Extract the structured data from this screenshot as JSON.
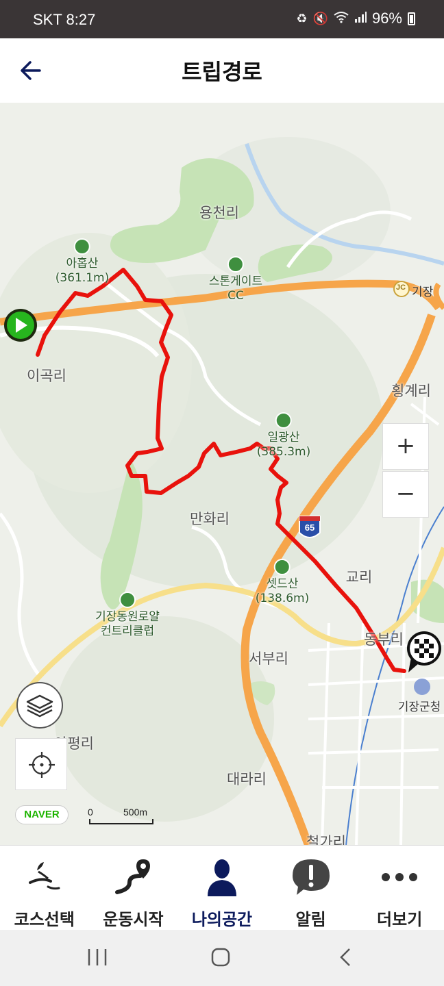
{
  "status_bar": {
    "carrier": "SKT",
    "time": "8:27",
    "battery": "96%",
    "icons": [
      "data-saver-icon",
      "mute-icon",
      "wifi-icon",
      "signal-icon",
      "battery-icon"
    ]
  },
  "app_bar": {
    "title": "트립경로",
    "back_icon": "arrow-left-icon"
  },
  "map": {
    "place_labels": [
      "용천리",
      "이곡리",
      "횡계리",
      "만화리",
      "교리",
      "동부리",
      "서부리",
      "기장군청",
      "아평리",
      "대라리",
      "철가리"
    ],
    "poi_labels": {
      "ahop": "아홉산\n(361.1m)",
      "stonegate": "스톤게이트\nCC",
      "ilgwang": "일광산\n(385.3m)",
      "setdeu": "셋드산\n(138.6m)",
      "golfclub": "기장동원로얄\n컨트리클럽"
    },
    "jc_badge": "JC",
    "jc_label": "기장",
    "highway_shield": "65",
    "zoom_in": "+",
    "zoom_out": "−",
    "logo": "NAVER",
    "scale_zero": "0",
    "scale_max": "500m",
    "route_color": "#e8120c",
    "start_marker_color": "#27b51e",
    "road_color": "#f6a54a"
  },
  "bottom_nav": [
    {
      "label": "코스선택",
      "icon": "course-select-icon",
      "active": false
    },
    {
      "label": "운동시작",
      "icon": "route-pin-icon",
      "active": false
    },
    {
      "label": "나의공간",
      "icon": "person-icon",
      "active": true
    },
    {
      "label": "알림",
      "icon": "alert-bubble-icon",
      "active": false
    },
    {
      "label": "더보기",
      "icon": "more-dots-icon",
      "active": false
    }
  ],
  "system_nav": [
    "recent-apps-icon",
    "home-icon",
    "back-icon"
  ]
}
